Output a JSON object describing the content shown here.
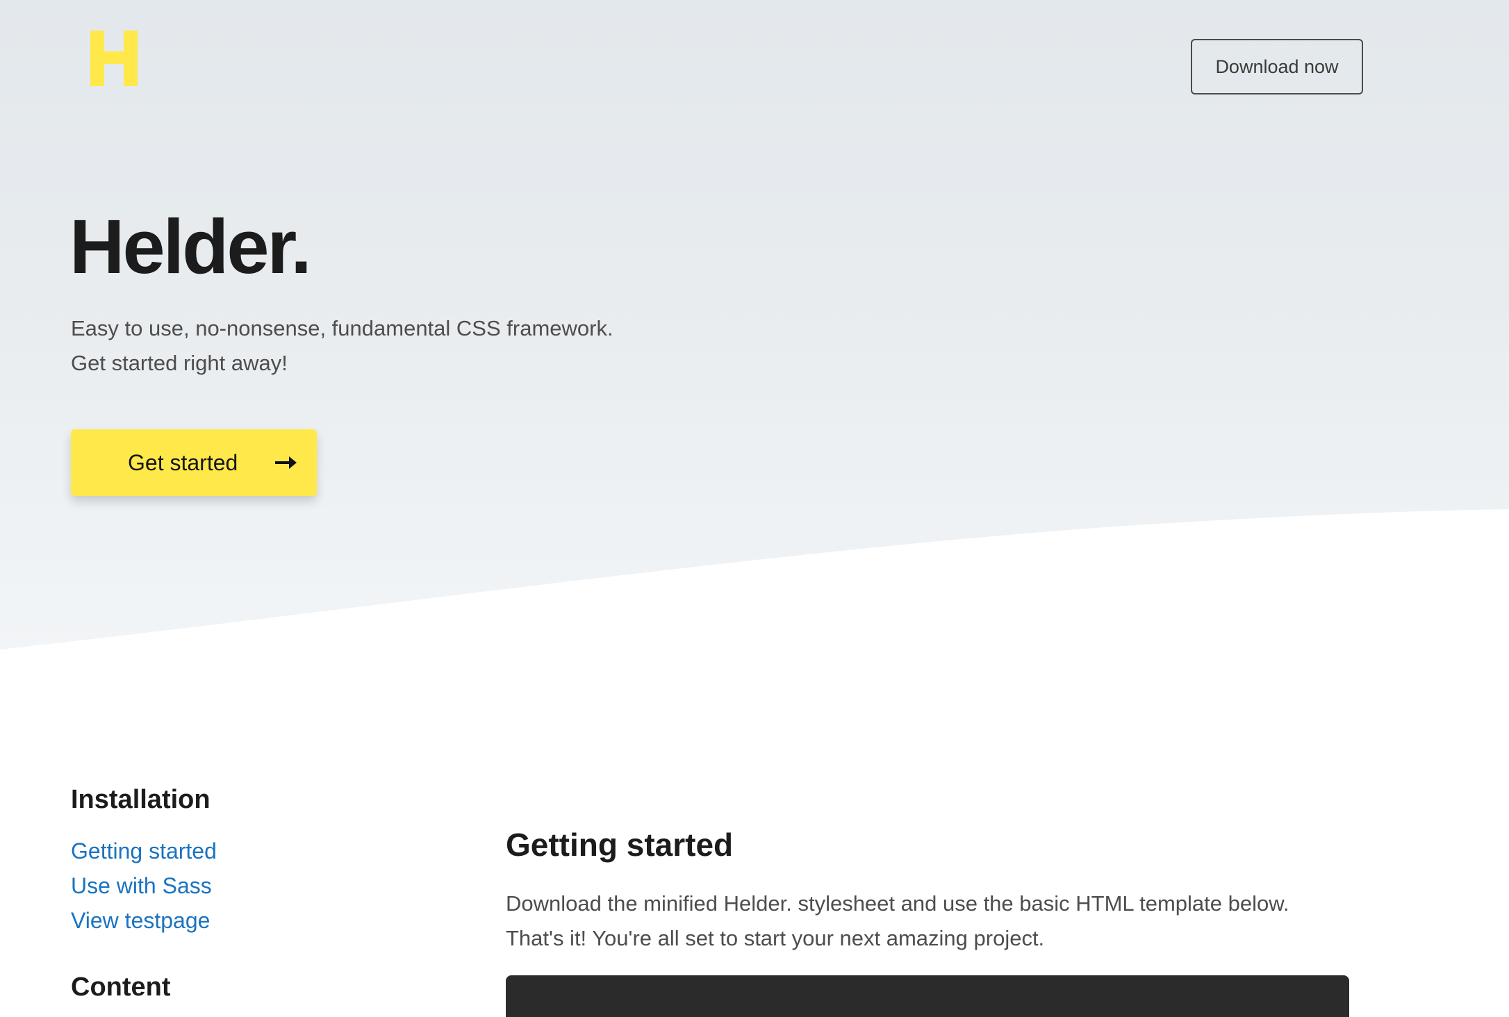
{
  "header": {
    "logo_letter": "H",
    "download_label": "Download now"
  },
  "hero": {
    "title": "Helder.",
    "subtitle_line1": "Easy to use, no-nonsense, fundamental CSS framework.",
    "subtitle_line2": "Get started right away!",
    "cta_label": "Get started",
    "cta_icon": "arrow-right-icon"
  },
  "sidebar": {
    "sections": [
      {
        "heading": "Installation",
        "links": [
          "Getting started",
          "Use with Sass",
          "View testpage"
        ]
      },
      {
        "heading": "Content"
      }
    ]
  },
  "main": {
    "title": "Getting started",
    "text_line1": "Download the minified Helder. stylesheet and use the basic HTML template below.",
    "text_line2": "That's it! You're all set to start your next amazing project."
  },
  "colors": {
    "accent_yellow": "#ffe94a",
    "link_blue": "#1a73c0",
    "code_bg": "#2b2b2b"
  }
}
